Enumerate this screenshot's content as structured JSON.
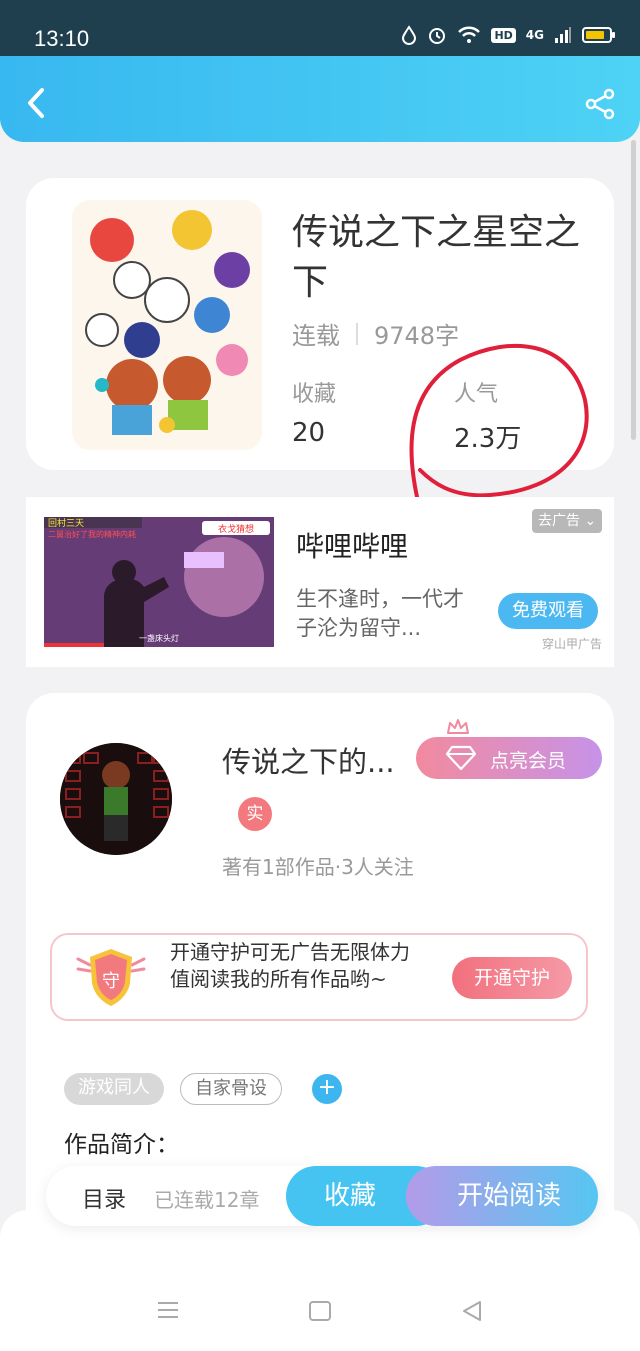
{
  "status_bar": {
    "time": "13:10",
    "network_type": "4G",
    "hd_label": "HD"
  },
  "header": {
    "back_icon": "chevron-left-icon",
    "share_icon": "share-icon"
  },
  "book": {
    "title": "传说之下之星空之下",
    "status": "连载",
    "word_count": "9748字",
    "favorites_label": "收藏",
    "favorites_value": "20",
    "popularity_label": "人气",
    "popularity_value": "2.3万"
  },
  "ad": {
    "title": "哔哩哔哩",
    "description": "生不逢时，一代才子沦为留守...",
    "close_label": "去广告",
    "watch_label": "免费观看",
    "source": "穿山甲广告",
    "thumb_caption_top": "回村三天",
    "thumb_caption_2": "二舅治好了我的精神内耗",
    "thumb_badge": "衣戈猜想",
    "thumb_subtitle": "一盏床头灯"
  },
  "author": {
    "name": "传说之下的...",
    "vip_label": "点亮会员",
    "real_badge": "实",
    "meta": "著有1部作品·3人关注"
  },
  "guard": {
    "icon_char": "守",
    "text": "开通守护可无广告无限体力值阅读我的所有作品哟~",
    "button": "开通守护"
  },
  "tags": [
    {
      "label": "游戏同人"
    },
    {
      "label": "自家骨设"
    }
  ],
  "add_tag": "+",
  "intro_title": "作品简介：",
  "bottom_bar": {
    "catalog": "目录",
    "chapters": "已连载12章",
    "favorite": "收藏",
    "read": "开始阅读"
  },
  "colors": {
    "header_start": "#38b8f0",
    "header_end": "#4ed2f5",
    "accent_blue": "#45c4f2",
    "accent_pink": "#f2707e",
    "annotation_red": "#e0203a"
  }
}
